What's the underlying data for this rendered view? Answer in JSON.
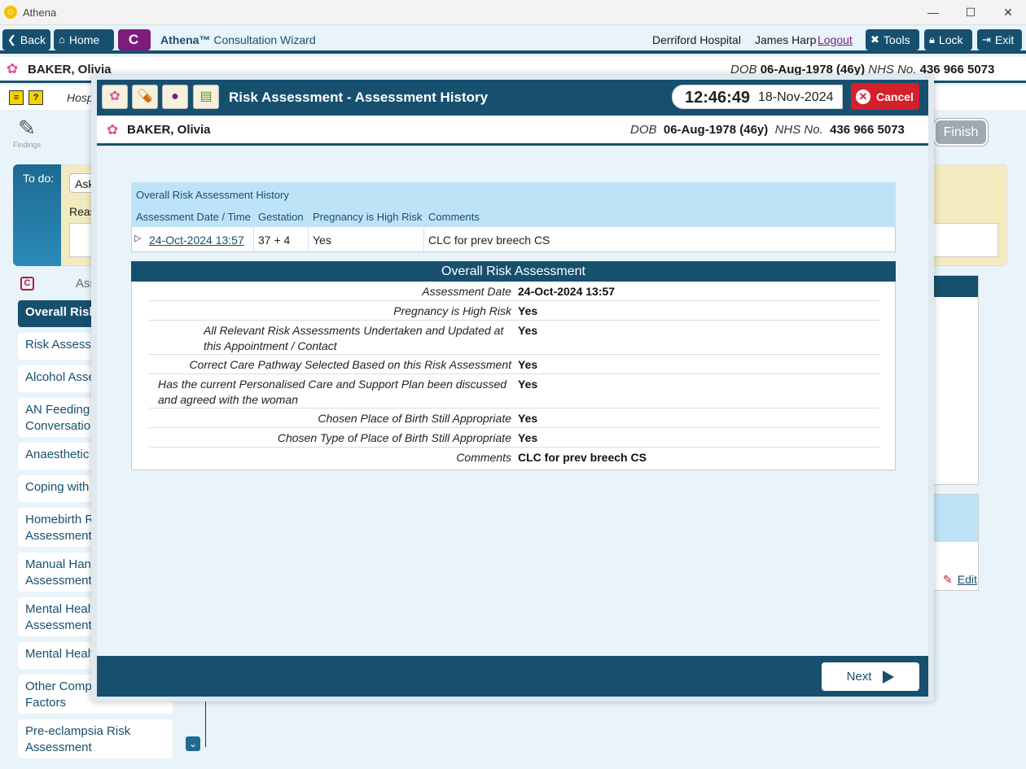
{
  "window": {
    "title": "Athena",
    "minimize": "—",
    "maximize": "☐",
    "close": "✕"
  },
  "toolbar": {
    "back": "Back",
    "home": "Home",
    "c_label": "C",
    "wizard_brand": "Athena™",
    "wizard_title": "Consultation Wizard",
    "hospital": "Derriford Hospital",
    "user": "James Harp",
    "logout": "Logout",
    "tools": "Tools",
    "lock": "Lock",
    "exit": "Exit"
  },
  "patient": {
    "name": "BAKER, Olivia",
    "dob_label": "DOB",
    "dob": "06-Aug-1978 (46y)",
    "nhs_label": "NHS No.",
    "nhs": "436 966 5073"
  },
  "background": {
    "hosp": "Hospi",
    "findings": "Findings",
    "finish": "Finish",
    "todo_label": "To do:",
    "todo_ask": "Ask",
    "todo_reason": "Reas",
    "left_head": "Ass",
    "nav": [
      "Overall Risk",
      "Risk Assessm",
      "Alcohol Asse",
      "AN Feeding\nConversation",
      "Anaesthetic",
      "Coping with",
      "Homebirth R\nAssessment",
      "Manual Hand\nAssessment",
      "Mental Healt\nAssessment",
      "Mental Healt",
      "Other Comp\nFactors",
      "Pre-eclampsia Risk\nAssessment"
    ],
    "edit": "Edit"
  },
  "modal": {
    "title": "Risk Assessment - Assessment History",
    "time": "12:46:49",
    "date": "18-Nov-2024",
    "cancel": "Cancel",
    "history": {
      "title": "Overall Risk Assessment History",
      "columns": [
        "Assessment Date / Time",
        "Gestation",
        "Pregnancy is High Risk",
        "Comments"
      ],
      "row": {
        "date": "24-Oct-2024 13:57",
        "gestation": "37 + 4",
        "high_risk": "Yes",
        "comments": "CLC for prev breech CS"
      }
    },
    "detail": {
      "title": "Overall Risk Assessment",
      "fields": [
        {
          "label": "Assessment Date",
          "value": "24-Oct-2024 13:57"
        },
        {
          "label": "Pregnancy is High Risk",
          "value": "Yes"
        },
        {
          "label": "All Relevant Risk Assessments Undertaken and Updated at this Appointment / Contact",
          "value": "Yes"
        },
        {
          "label": "Correct Care Pathway Selected Based on this Risk Assessment",
          "value": "Yes"
        },
        {
          "label": "Has the current Personalised Care and Support Plan been discussed and agreed with the woman",
          "value": "Yes"
        },
        {
          "label": "Chosen Place of Birth Still Appropriate",
          "value": "Yes"
        },
        {
          "label": "Chosen Type of Place of Birth Still Appropriate",
          "value": "Yes"
        },
        {
          "label": "Comments",
          "value": "CLC for prev breech CS"
        }
      ]
    },
    "next": "Next"
  }
}
